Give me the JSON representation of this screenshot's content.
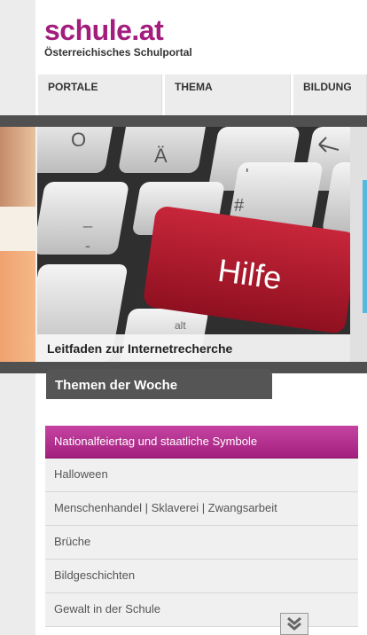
{
  "header": {
    "logo_title": "schule.at",
    "logo_subtitle": "Österreichisches Schulportal"
  },
  "nav": {
    "tabs": [
      {
        "label": "PORTALE"
      },
      {
        "label": "THEMA"
      },
      {
        "label": "BILDUNG"
      }
    ]
  },
  "carousel": {
    "slide_caption": "Leitfaden zur Internetrecherche",
    "key_label": "Hilfe",
    "key_glyphs": [
      "O",
      "Ä",
      "#",
      "'",
      "alt",
      "_",
      "-"
    ]
  },
  "themen": {
    "title": "Themen der Woche",
    "items": [
      {
        "label": "Nationalfeiertag und staatliche Symbole",
        "active": true
      },
      {
        "label": "Halloween"
      },
      {
        "label": "Menschenhandel | Sklaverei | Zwangsarbeit"
      },
      {
        "label": "Brüche"
      },
      {
        "label": "Bildgeschichten"
      },
      {
        "label": "Gewalt in der Schule"
      }
    ],
    "scroll_icon": "chevron-double-down-icon"
  },
  "colors": {
    "brand": "#a31d7d",
    "active_item": "#b8318f",
    "dark_bar": "#505050",
    "key_red": "#b0182a"
  }
}
